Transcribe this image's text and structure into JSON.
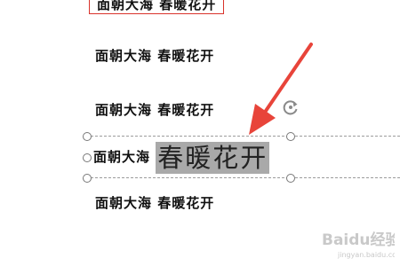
{
  "document": {
    "lines": [
      {
        "text": "面朝大海 春暖花开"
      },
      {
        "text": "面朝大海 春暖花开"
      },
      {
        "text": "面朝大海 春暖花开"
      },
      {
        "text_prefix": "面朝大海 ",
        "text_selected": "春暖花开"
      },
      {
        "text": "面朝大海 春暖花开"
      }
    ]
  },
  "colors": {
    "annotation": "#e8443a",
    "selection": "#a9a9a9",
    "highlight_box": "#d9332b"
  },
  "icons": {
    "rotate": "rotate-icon",
    "arrow": "red-arrow-annotation"
  },
  "watermark": {
    "brand": "Baidu经验",
    "url": "jingyan.baidu.com"
  }
}
